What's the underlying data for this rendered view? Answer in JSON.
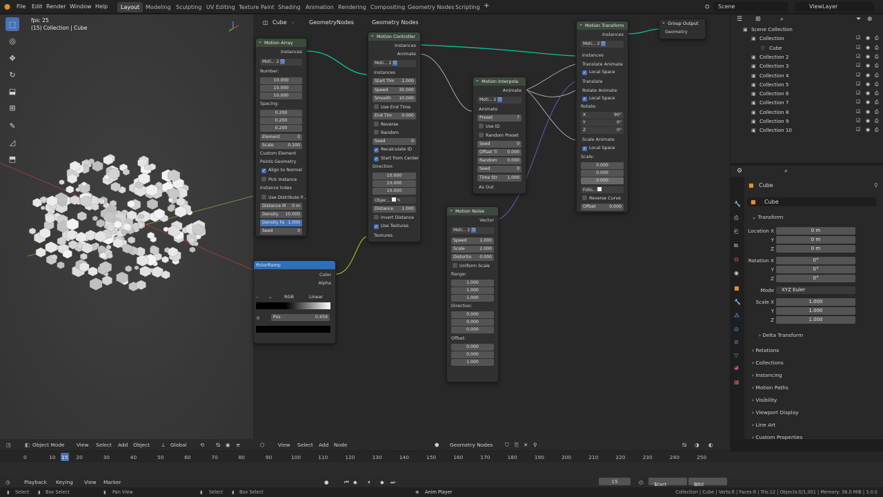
{
  "topbar": {
    "menus": [
      "File",
      "Edit",
      "Render",
      "Window",
      "Help"
    ],
    "workspaces": [
      "Layout",
      "Modeling",
      "Sculpting",
      "UV Editing",
      "Texture Paint",
      "Shading",
      "Animation",
      "Rendering",
      "Compositing",
      "Geometry Nodes",
      "Scripting"
    ],
    "active_workspace": "Layout",
    "add_tab": "+",
    "scene": "Scene",
    "view_layer": "ViewLayer"
  },
  "viewport": {
    "fps": "fps: 25",
    "collection_info": "(15) Collection | Cube",
    "header": {
      "mode": "Object Mode",
      "menus": [
        "View",
        "Select",
        "Add",
        "Object"
      ],
      "orientation": "Global"
    }
  },
  "node_editor": {
    "breadcrumb": [
      "Cube",
      "GeometryNodes",
      "Geometry Nodes"
    ],
    "header_menus": [
      "View",
      "Select",
      "Add",
      "Node"
    ],
    "tree_name": "Geometry Nodes",
    "nodes": {
      "motion_array": {
        "title": "Motion Array",
        "out": "Instances",
        "dropdown": "Moti...",
        "users": "2",
        "number_label": "Number:",
        "number": [
          "10.000",
          "10.000",
          "10.000"
        ],
        "spacing_label": "Spacing:",
        "spacing": [
          "0.200",
          "0.200",
          "0.200"
        ],
        "element": {
          "label": "Element",
          "value": "0"
        },
        "scale": {
          "label": "Scale",
          "value": "0.100"
        },
        "custom_element": "Custom Element",
        "points_geometry": "Points Geometry",
        "align_to_normal": "Align to Normal",
        "pick_instance": "Pick Instance",
        "instance_index": "Instance Index",
        "use_distribute": "Use Distribute P...",
        "distance": {
          "label": "Distance M",
          "value": "0 m"
        },
        "density": {
          "label": "Density",
          "value": "10.000"
        },
        "density_fa": {
          "label": "Density Fa",
          "value": "1.000"
        },
        "seed": {
          "label": "Seed",
          "value": "0"
        }
      },
      "motion_controller": {
        "title": "Motion Controller",
        "outs": [
          "Instances",
          "Animate"
        ],
        "dropdown": "Moti...",
        "users": "2",
        "in_instances": "Instances",
        "start_time": {
          "label": "Start Tim",
          "value": "1.000"
        },
        "speed": {
          "label": "Speed",
          "value": "30.000"
        },
        "smooth": {
          "label": "Smooth",
          "value": "10.000"
        },
        "use_end_time": "Use End Time",
        "end_time": {
          "label": "End Tim",
          "value": "0.000"
        },
        "reverse": "Reverse",
        "random": "Random",
        "seed": {
          "label": "Seed",
          "value": "0"
        },
        "recalculate_id": "Recalculate ID",
        "start_from_center": "Start from Center",
        "direction_label": "Direction:",
        "direction": [
          "10.000",
          "10.000",
          "10.000"
        ],
        "object": "Objec...",
        "distance": {
          "label": "Distance",
          "value": "1.000"
        },
        "invert_distance": "Invert Distance",
        "use_textures": "Use Textures",
        "textures": "Textures"
      },
      "motion_interpolate": {
        "title": "Motion Interpola",
        "out": "Animate",
        "dropdown": "Moti...",
        "users": "2",
        "in_animate": "Animate",
        "preset": {
          "label": "Preset",
          "value": "7"
        },
        "use_id": "Use ID",
        "random_preset": "Random Preset",
        "seed1": {
          "label": "Seed",
          "value": "0"
        },
        "offset_time": {
          "label": "Offset Ti",
          "value": "0.000"
        },
        "random": {
          "label": "Random",
          "value": "0.000"
        },
        "seed2": {
          "label": "Seed",
          "value": "0"
        },
        "time_str": {
          "label": "Time Str",
          "value": "1.000"
        },
        "as_out": "As Out"
      },
      "motion_noise": {
        "title": "Motion Noise",
        "out": "Vector",
        "dropdown": "Moti...",
        "users": "2",
        "speed": {
          "label": "Speed",
          "value": "1.000"
        },
        "scale": {
          "label": "Scale",
          "value": "2.000"
        },
        "distortion": {
          "label": "Distortio",
          "value": "0.000"
        },
        "uniform_scale": "Uniform Scale",
        "range_label": "Range:",
        "range": [
          "1.000",
          "1.000",
          "1.000"
        ],
        "direction_label": "Direction:",
        "direction": [
          "0.000",
          "0.000",
          "0.000"
        ],
        "offset_label": "Offset:",
        "offset": [
          "0.000",
          "0.000",
          "1.000"
        ]
      },
      "motion_transform": {
        "title": "Motion Transform",
        "out": "Instances",
        "dropdown": "Moti...",
        "users": "2",
        "in_instances": "Instances",
        "translate_animate": "Translate Animate",
        "local_space": "Local Space",
        "translate": "Translate",
        "rotate_animate": "Rotate Animate",
        "rotate_label": "Rotate:",
        "rotate": [
          {
            "axis": "X",
            "value": "90°"
          },
          {
            "axis": "Y",
            "value": "0°"
          },
          {
            "axis": "Z",
            "value": "0°"
          }
        ],
        "scale_animate": "Scale Animate",
        "scale_label": "Scale:",
        "scale": [
          "0.000",
          "0.000",
          "0.000"
        ],
        "follow": "Follo...",
        "reverse_curve": "Reverse Curve",
        "offset": {
          "label": "Offset",
          "value": "0.000"
        }
      },
      "group_output": {
        "title": "Group Output",
        "in": "Geometry"
      },
      "color_ramp": {
        "title": "ColorRamp",
        "outs": [
          "Color",
          "Alpha"
        ],
        "mode": "RGB",
        "interp": "Linear",
        "index": "0",
        "pos_label": "Pos",
        "pos": "0.459"
      }
    }
  },
  "outliner": {
    "items": [
      "Scene Collection",
      "Collection",
      "Cube",
      "Collection 2",
      "Collection 3",
      "Collection 4",
      "Collection 5",
      "Collection 6",
      "Collection 7",
      "Collection 8",
      "Collection 9",
      "Collection 10"
    ]
  },
  "properties": {
    "object_name": "Cube",
    "data_name": "Cube",
    "transform_label": "Transform",
    "location_label": "Location X",
    "location": [
      "0 m",
      "0 m",
      "0 m"
    ],
    "rotation_label": "Rotation X",
    "rotation": [
      "0°",
      "0°",
      "0°"
    ],
    "mode_label": "Mode",
    "mode": "XYZ Euler",
    "scale_label": "Scale X",
    "scale": [
      "1.000",
      "1.000",
      "1.000"
    ],
    "axis_y": "Y",
    "axis_z": "Z",
    "panels": [
      "Delta Transform",
      "Relations",
      "Collections",
      "Instancing",
      "Motion Paths",
      "Visibility",
      "Viewport Display",
      "Line Art",
      "Custom Properties"
    ]
  },
  "timeline": {
    "ticks": [
      "0",
      "10",
      "15",
      "20",
      "30",
      "40",
      "50",
      "60",
      "70",
      "80",
      "90",
      "100",
      "110",
      "120",
      "130",
      "140",
      "150",
      "160",
      "170",
      "180",
      "190",
      "200",
      "210",
      "220",
      "230",
      "240",
      "250"
    ],
    "current_frame": "15",
    "menus": [
      "Playback",
      "Keying",
      "View",
      "Marker"
    ],
    "frame_field": "15",
    "start_label": "Start",
    "start": "1",
    "end_label": "End",
    "end": "80"
  },
  "statusbar": {
    "left": [
      "Select",
      "Box Select",
      "Pan View",
      "Select",
      "Box Select"
    ],
    "center": "Anim Player",
    "right": "Collection | Cube | Verts:8 | Faces:6 | Tris:12 | Objects:0/1,001 | Memory: 38.0 MiB | 3.0.0"
  },
  "colors": {
    "accent": "#4772b3",
    "node_header": "#3c4a3c",
    "link": "#00c8a0"
  }
}
